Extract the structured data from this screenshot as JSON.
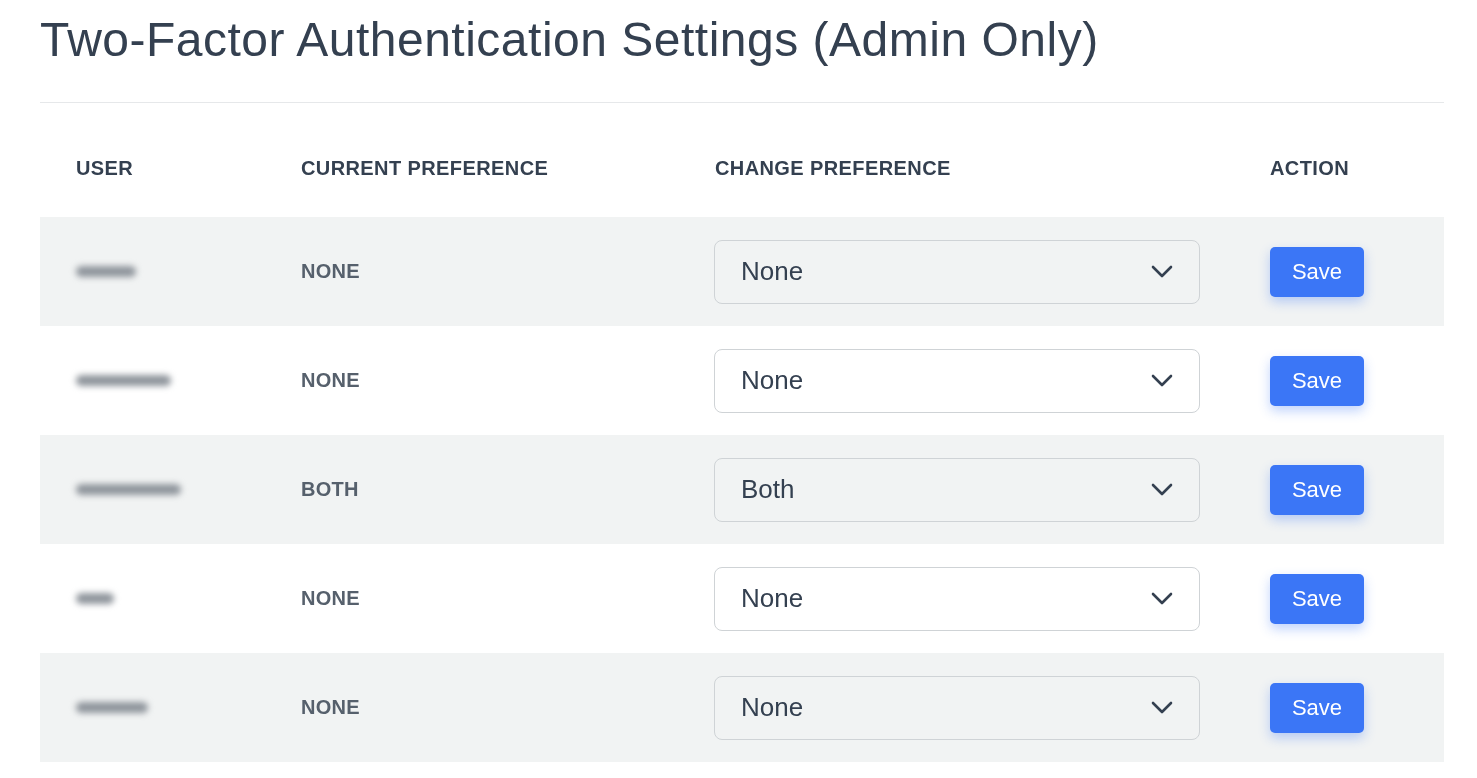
{
  "title": "Two-Factor Authentication Settings (Admin Only)",
  "table": {
    "columns": [
      "USER",
      "CURRENT PREFERENCE",
      "CHANGE PREFERENCE",
      "ACTION"
    ],
    "rows": [
      {
        "current_preference": "NONE",
        "change_preference": "None",
        "action": "Save"
      },
      {
        "current_preference": "NONE",
        "change_preference": "None",
        "action": "Save"
      },
      {
        "current_preference": "BOTH",
        "change_preference": "Both",
        "action": "Save"
      },
      {
        "current_preference": "NONE",
        "change_preference": "None",
        "action": "Save"
      },
      {
        "current_preference": "NONE",
        "change_preference": "None",
        "action": "Save"
      }
    ]
  }
}
